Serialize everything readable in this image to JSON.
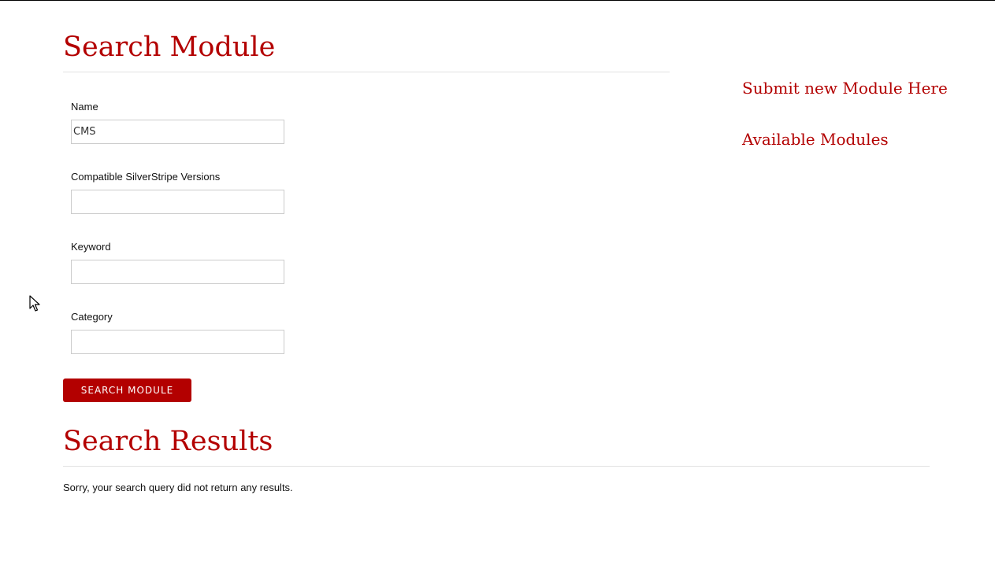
{
  "search_form": {
    "heading": "Search Module",
    "fields": [
      {
        "label": "Name",
        "value": "CMS",
        "placeholder": ""
      },
      {
        "label": "Compatible SilverStripe Versions",
        "value": "",
        "placeholder": ""
      },
      {
        "label": "Keyword",
        "value": "",
        "placeholder": ""
      },
      {
        "label": "Category",
        "value": "",
        "placeholder": ""
      }
    ],
    "submit_label": "Search Module"
  },
  "sidebar": {
    "links": [
      {
        "label": "Submit new Module Here"
      },
      {
        "label": "Available Modules"
      }
    ]
  },
  "results": {
    "heading": "Search Results",
    "message": "Sorry, your search query did not return any results."
  },
  "colors": {
    "accent": "#b30000",
    "text": "#111111",
    "divider": "#e2e2e2"
  },
  "cursor": {
    "icon": "mouse-pointer-icon"
  }
}
